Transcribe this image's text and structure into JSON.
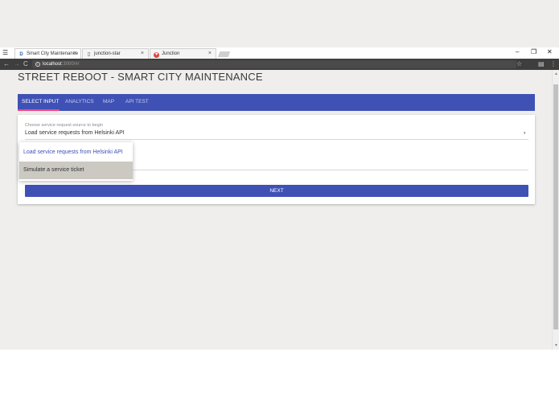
{
  "browser": {
    "tabs": [
      {
        "favicon": "D",
        "title": "Smart City Maintenance",
        "close": "×"
      },
      {
        "favicon": "▯",
        "title": "junction-star",
        "close": "×"
      },
      {
        "favicon": "♥",
        "title": "Junction",
        "close": "×"
      }
    ],
    "window_controls": {
      "minimize": "–",
      "maximize": "❐",
      "close": "✕"
    },
    "menu_glyph": "☰",
    "nav": {
      "back": "←",
      "forward": "→",
      "reload": "C"
    },
    "address": {
      "host": "localhost",
      "path": ":3000/#/",
      "info_glyph": "i"
    },
    "toolbar_right": {
      "star": "☆",
      "extensions": "▤",
      "menu": "⋮"
    },
    "scroll_arrows": {
      "up": "▲",
      "down": "▼"
    }
  },
  "page": {
    "title": "STREET REBOOT - SMART CITY MAINTENANCE"
  },
  "nav_tabs": [
    {
      "label": "SELECT INPUT",
      "active": true
    },
    {
      "label": "ANALYTICS",
      "active": false
    },
    {
      "label": "MAP",
      "active": false
    },
    {
      "label": "API TEST",
      "active": false
    }
  ],
  "form": {
    "select_label": "Choose service request source to begin",
    "select_value": "Load service requests from Helsinki API",
    "select_arrow": "▾",
    "next_label": "NEXT"
  },
  "dropdown": {
    "options": [
      {
        "label": "Load service requests from Helsinki API",
        "selected": true
      },
      {
        "label": "Simulate a service ticket",
        "highlighted": true
      }
    ]
  },
  "colors": {
    "primary": "#3f51b5",
    "accent": "#ff4081",
    "background": "#efeeec"
  }
}
